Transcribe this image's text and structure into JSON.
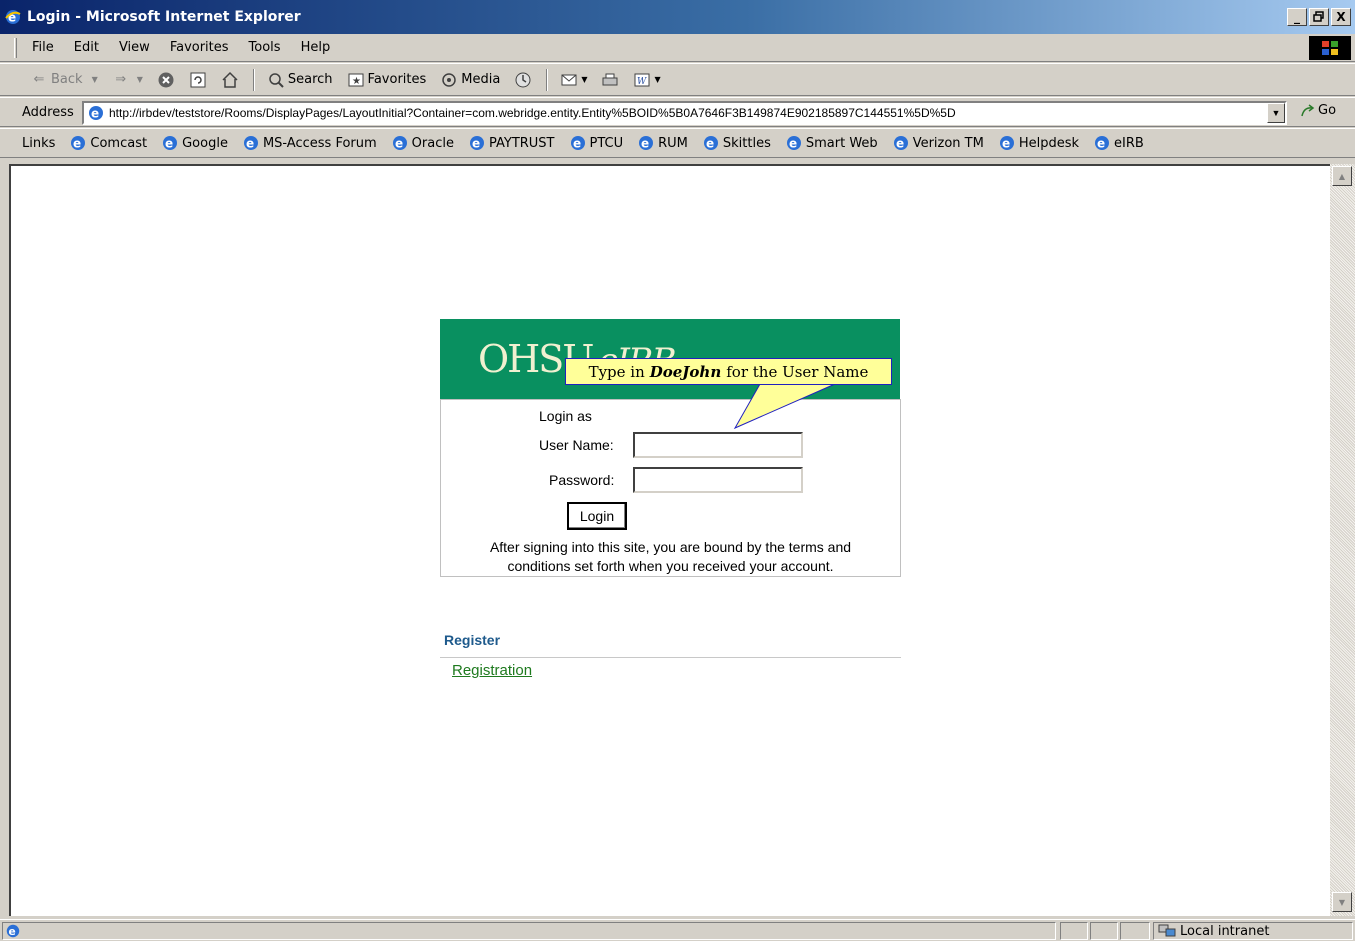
{
  "window": {
    "title": "Login - Microsoft Internet Explorer",
    "minimize": "_",
    "restore": "·",
    "close": "X"
  },
  "menu": [
    "File",
    "Edit",
    "View",
    "Favorites",
    "Tools",
    "Help"
  ],
  "toolbar": {
    "back": "Back",
    "search": "Search",
    "favorites": "Favorites",
    "media": "Media"
  },
  "address": {
    "label": "Address",
    "url": "http://irbdev/teststore/Rooms/DisplayPages/LayoutInitial?Container=com.webridge.entity.Entity%5BOID%5B0A7646F3B149874E902185897C144551%5D%5D",
    "go": "Go"
  },
  "links": {
    "label": "Links",
    "items": [
      "Comcast",
      "Google",
      "MS-Access Forum",
      "Oracle",
      "PAYTRUST",
      "PTCU",
      "RUM",
      "Skittles",
      "Smart Web",
      "Verizon TM",
      "Helpdesk",
      "eIRB"
    ]
  },
  "login": {
    "header_main": "OHSU",
    "header_sub": "eIRB",
    "login_as": "Login as",
    "username_label": "User Name:",
    "username_value": "",
    "password_label": "Password:",
    "password_value": "",
    "button": "Login",
    "note_line1": "After signing into this site, you are bound by the terms and",
    "note_line2": "conditions set forth when you received your account."
  },
  "callout": {
    "prefix": "Type in",
    "emphasis": "DoeJohn",
    "suffix": "for the User Name"
  },
  "register": {
    "heading": "Register",
    "link": "Registration"
  },
  "status": {
    "zone": "Local intranet"
  },
  "colors": {
    "header_green": "#099060",
    "register_blue": "#1e5a8c",
    "link_green": "#1e7a1e",
    "callout_fill": "#ffff99"
  }
}
